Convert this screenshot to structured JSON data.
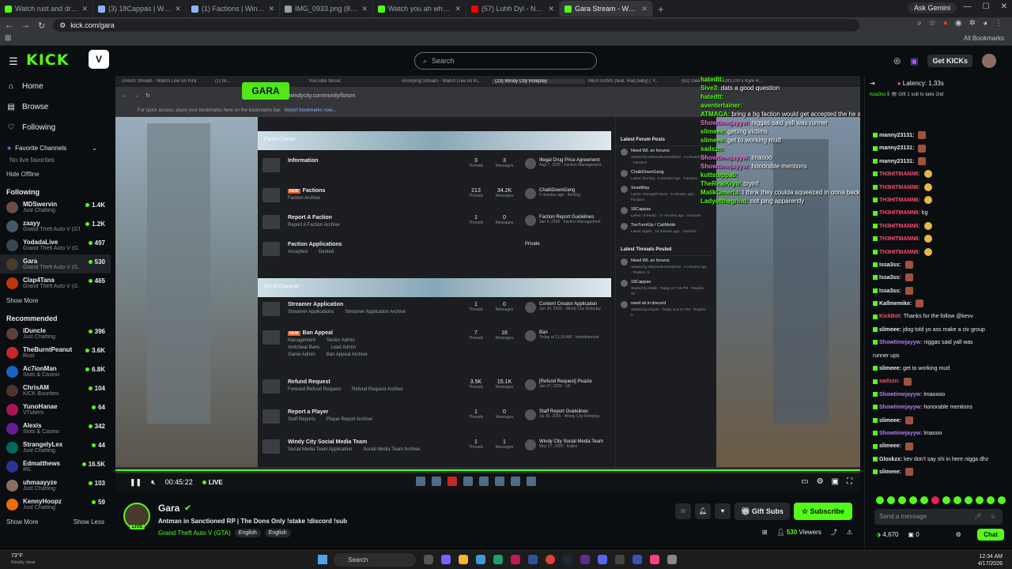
{
  "browser": {
    "tabs": [
      {
        "title": "Watch rust and drive in a new vic...",
        "color": "#53fc18"
      },
      {
        "title": "(3) 18Cappas | Windy City Rol...",
        "color": "#8ab4f8"
      },
      {
        "title": "(1) Factions | Windy City Rolepl...",
        "color": "#8ab4f8"
      },
      {
        "title": "IMG_0933.png (892×280)",
        "color": "#9aa0a6"
      },
      {
        "title": "Watch you ah what? | Streamin...",
        "color": "#53fc18"
      },
      {
        "title": "(57) Luhh Dyl - Nobody Gone L...",
        "color": "#ff0000"
      },
      {
        "title": "Gara Stream - Watch Live on Ki...",
        "color": "#53fc18",
        "active": true
      }
    ],
    "ask_gemini": "Ask Gemini",
    "url": "kick.com/gara",
    "all_bookmarks": "All Bookmarks"
  },
  "header": {
    "logo": "KICK",
    "search_placeholder": "Search",
    "get_kicks": "Get KICKs"
  },
  "sidebar": {
    "nav": [
      {
        "label": "Home",
        "icon": "home-icon"
      },
      {
        "label": "Browse",
        "icon": "browse-icon"
      },
      {
        "label": "Following",
        "icon": "heart-icon"
      }
    ],
    "favorite_channels": "Favorite Channels",
    "no_live_favorites": "No live favorites",
    "hide_offline": "Hide Offline",
    "following_title": "Following",
    "following": [
      {
        "name": "MDSwervin",
        "category": "Just Chatting",
        "viewers": "1.4K",
        "color": "#6d4c41"
      },
      {
        "name": "zaayy",
        "category": "Grand Theft Auto V (GT...",
        "viewers": "1.2K",
        "color": "#455a64"
      },
      {
        "name": "YodadaLive",
        "category": "Grand Theft Auto V (G...",
        "viewers": "497",
        "color": "#37474f"
      },
      {
        "name": "Gara",
        "category": "Grand Theft Auto V (G...",
        "viewers": "530",
        "color": "#4a3a2e"
      },
      {
        "name": "Clap4Tana",
        "category": "Grand Theft Auto V (G...",
        "viewers": "465",
        "color": "#bf360c"
      }
    ],
    "show_more_1": "Show More",
    "recommended_title": "Recommended",
    "recommended": [
      {
        "name": "iDuncle",
        "category": "Just Chatting",
        "viewers": "396",
        "color": "#5d4037"
      },
      {
        "name": "TheBurntPeanut",
        "category": "Rust",
        "viewers": "3.6K",
        "color": "#c62828"
      },
      {
        "name": "Ac7ionMan",
        "category": "Slots & Casino",
        "viewers": "6.8K",
        "color": "#1565c0"
      },
      {
        "name": "ChrisAM",
        "category": "KICK Bounties",
        "viewers": "104",
        "color": "#4e342e"
      },
      {
        "name": "YunoHanae",
        "category": "VTubers",
        "viewers": "64",
        "color": "#ad1457"
      },
      {
        "name": "Alexis",
        "category": "Slots & Casino",
        "viewers": "342",
        "color": "#6a1b9a"
      },
      {
        "name": "StrangelyLex",
        "category": "Just Chatting",
        "viewers": "44",
        "color": "#00695c"
      },
      {
        "name": "Edmatthews",
        "category": "IRL",
        "viewers": "16.5K",
        "color": "#283593"
      },
      {
        "name": "uhmaayyze",
        "category": "Just Chatting",
        "viewers": "103",
        "color": "#8d6e63"
      },
      {
        "name": "KennyHoopz",
        "category": "Just Chatting",
        "viewers": "59",
        "color": "#ef6c00"
      }
    ],
    "show_more_2": "Show More",
    "show_less": "Show Less"
  },
  "video": {
    "inner_tabs": [
      "Grinch Stream - Watch Live on Kick",
      "(1) Bi...",
      "YouTube Music",
      "Annoying Stream - Watch Live on Ki...",
      "(23) Windy City Roleplay",
      "MENTIONS (feat. Raq baby) | Y...",
      "(62) Dee Billz x VonOff1700 x Kyle R..."
    ],
    "inner_url": "windycity.community/forum",
    "inner_bookmarks": "For quick access, place your bookmarks here on the bookmarks bar.",
    "inner_bookmarks_link": "Import bookmarks now...",
    "overlay_logo": "GARA",
    "faction_header": "Faction Center",
    "ooc_header": "Out of Character",
    "forums": [
      {
        "title": "Information",
        "subs": [],
        "threads": "3",
        "messages": "3",
        "last": "Illegal Drug Price Agreement",
        "last_sub": "Aug 7, 2025 · Faction Management"
      },
      {
        "title": "Factions",
        "hot": "NEW",
        "subs": [
          "Faction Archive"
        ],
        "threads": "213",
        "messages": "34.2K",
        "last": "ChalkDownGang",
        "last_sub": "5 minutes ago · fleming"
      },
      {
        "title": "Report A Faction",
        "subs": [
          "Report A Faction Archive"
        ],
        "threads": "1",
        "messages": "0",
        "last": "Faction Report Guidelines",
        "last_sub": "Jan 4, 2025 · Faction Management"
      },
      {
        "title": "Faction Applications",
        "subs": [
          "Accepted",
          "Denied"
        ],
        "threads": "",
        "messages": "",
        "last": "Private",
        "last_sub": ""
      },
      {
        "title": "Streamer Application",
        "subs": [
          "Streamer Applications",
          "Streamer Application Archive"
        ],
        "threads": "1",
        "messages": "0",
        "last": "Content Creator Application",
        "last_sub": "Jun 30, 2025 · Windy City Roleplay"
      },
      {
        "title": "Ban Appeal",
        "hot": "NEW",
        "subs": [
          "Management",
          "Senior Admin",
          "Anticheat Bans",
          "Lead Admin",
          "Game Admin",
          "Ban Appeal Archive"
        ],
        "threads": "7",
        "messages": "16",
        "last": "Ban",
        "last_sub": "Today at 11:10 AM · feedsthemost"
      },
      {
        "title": "Refund Request",
        "subs": [
          "Forward Refund Request",
          "Refund Request Archive"
        ],
        "threads": "3.5K",
        "messages": "15.1K",
        "last": "[Refund Request] Peazie",
        "last_sub": "Jan 27, 2026 · LB"
      },
      {
        "title": "Report a Player",
        "subs": [
          "Staff Reports",
          "Player Report Archive"
        ],
        "threads": "1",
        "messages": "0",
        "last": "Staff Report Guidelines",
        "last_sub": "Jul 30, 2025 · Windy City Roleplay"
      },
      {
        "title": "Windy City Social Media Team",
        "subs": [
          "Social Media Team Application",
          "Social Media Team Archive"
        ],
        "threads": "1",
        "messages": "1",
        "last": "Windy City Social Media Team",
        "last_sub": "May 27, 2026 · Kallex"
      }
    ],
    "threads_label": "Threads",
    "messages_label": "Messages",
    "latest_posts_title": "Latest Forum Posts",
    "latest_posts": [
      {
        "title": "Need WL on forums",
        "meta": "Started by MissunderstoodOne · 4 minutes ago · Factions"
      },
      {
        "title": "ChalkDownGang",
        "meta": "Latest: fleming · 5 minutes ago · Factions"
      },
      {
        "title": "SosaWay",
        "meta": "Latest: GeorgePickens · 5 minutes ago · Factions"
      },
      {
        "title": "18Cappas",
        "meta": "Latest: chriswfd · 17 minutes ago · Factions"
      },
      {
        "title": "TooTurntUp / CaliMobb",
        "meta": "Latest: tigerk · 18 minutes ago · Factions"
      }
    ],
    "latest_threads_title": "Latest Threads Posted",
    "latest_threads": [
      {
        "title": "Need WL on forums",
        "meta": "Started by MissunderstoodOne · 4 minutes ago · Replies: 0"
      },
      {
        "title": "18Cappas",
        "meta": "Started by Malik · Today at 7:26 PM · Replies: 20"
      },
      {
        "title": "need wl in discord",
        "meta": "Started by ishyah · Today at 6:47 PM · Replies: 0"
      }
    ],
    "overlay_chat": [
      {
        "user": "hatedtt:",
        "text": ""
      },
      {
        "user": "Sive3:",
        "text": "dats a good question"
      },
      {
        "user": "hatedtt:",
        "text": ""
      },
      {
        "user": "aventertainer:",
        "text": ""
      },
      {
        "user": "ATMAGA:",
        "text": "bring a bg faction would get accepted the he a troll"
      },
      {
        "user": "Showtimejayyw:",
        "text": "niggas said yall was runner"
      },
      {
        "user": "slimeee:",
        "text": "getting victims"
      },
      {
        "user": "slimeee:",
        "text": "get to working mud"
      },
      {
        "user": "sadszn:",
        "text": ""
      },
      {
        "user": "Showtimejayyw:",
        "text": "lmaooo"
      },
      {
        "user": "Showtimejayyw:",
        "text": "honorable mentions"
      },
      {
        "user": "kuttsteppa0:",
        "text": ""
      },
      {
        "user": "TheRealKryo:",
        "text": "cryinf"
      },
      {
        "user": "MalikOmerta:",
        "text": "I think they coulda squeezed in onna backened"
      },
      {
        "user": "Ladyofthegrind:",
        "text": "not ping apparently"
      }
    ],
    "time": "00:45:22",
    "live": "LIVE"
  },
  "stream": {
    "name": "Gara",
    "live_badge": "LIVE",
    "title": "Antman in Sanctioned RP | The Dons Only !stake !discord !sub",
    "category": "Grand Theft Auto V (GTA)",
    "tags": [
      "English",
      "English"
    ],
    "gift_subs": "Gift Subs",
    "subscribe": "Subscribe",
    "viewers": "530",
    "viewers_label": "Viewers"
  },
  "chat": {
    "latency": "Latency: 1.33s",
    "pinned_user": "Issa3ss",
    "pinned_count": "5",
    "pinned_text": "Gift 1 sub to take 2nd",
    "messages": [
      {
        "user": "manny23131:",
        "text": "",
        "color": "#e8eaed",
        "emote": true
      },
      {
        "user": "manny23131:",
        "text": "",
        "color": "#e8eaed",
        "emote": true
      },
      {
        "user": "manny23131:",
        "text": "",
        "color": "#e8eaed",
        "emote": true
      },
      {
        "user": "TH3HITMANN6:",
        "text": "",
        "color": "#ff4d6d",
        "emote_y": true
      },
      {
        "user": "TH3HITMANN6:",
        "text": "",
        "color": "#ff4d6d",
        "emote_y": true
      },
      {
        "user": "TH3HITMANN6:",
        "text": "",
        "color": "#ff4d6d",
        "emote_y": true
      },
      {
        "user": "TH3HITMANN6:",
        "text": "bg",
        "color": "#ff4d6d"
      },
      {
        "user": "TH3HITMANN6:",
        "text": "",
        "color": "#ff4d6d",
        "emote_y": true
      },
      {
        "user": "TH3HITMANN6:",
        "text": "",
        "color": "#ff4d6d",
        "emote_y": true
      },
      {
        "user": "TH3HITMANN6:",
        "text": "",
        "color": "#ff4d6d",
        "emote_y": true
      },
      {
        "user": "Issa3ss:",
        "text": "",
        "color": "#e8eaed",
        "emote": true
      },
      {
        "user": "Issa3ss:",
        "text": "",
        "color": "#e8eaed",
        "emote": true
      },
      {
        "user": "Issa3ss:",
        "text": "",
        "color": "#e8eaed",
        "emote": true
      },
      {
        "user": "Kallmemike:",
        "text": "",
        "color": "#e8eaed",
        "emote": true
      },
      {
        "user": "KickBot:",
        "text": "Thanks for the follow @kevv",
        "color": "#ff4d6d"
      },
      {
        "user": "slimeee:",
        "text": "jdog told yo ass make a civ group",
        "color": "#e8eaed"
      },
      {
        "user": "Showtimejayyw:",
        "text": "niggas said yall was",
        "color": "#b57cf0"
      },
      {
        "user": "",
        "text": "runner ups",
        "color": "#e8eaed"
      },
      {
        "user": "slimeee:",
        "text": "get to working mud",
        "color": "#e8eaed"
      },
      {
        "user": "sadszn:",
        "text": "",
        "color": "#ff4d6d",
        "emote": true
      },
      {
        "user": "Showtimejayyw:",
        "text": "lmaoooo",
        "color": "#b57cf0"
      },
      {
        "user": "Showtimejayyw:",
        "text": "honorable mentions",
        "color": "#b57cf0"
      },
      {
        "user": "slimeee:",
        "text": "",
        "color": "#e8eaed",
        "emote": true
      },
      {
        "user": "Showtimejayyw:",
        "text": "lmaooo",
        "color": "#b57cf0"
      },
      {
        "user": "slimeee:",
        "text": "",
        "color": "#e8eaed",
        "emote": true
      },
      {
        "user": "Gloxkzx:",
        "text": "kev don't say shi in here nigga dhz",
        "color": "#e8eaed"
      },
      {
        "user": "slimeee:",
        "text": "",
        "color": "#e8eaed",
        "emote": true
      }
    ],
    "placeholder": "Send a message",
    "points": "4,670",
    "zero": "0",
    "chat_button": "Chat"
  },
  "taskbar": {
    "temp": "73°F",
    "weather": "Mostly clear",
    "search": "Search",
    "time": "12:34 AM",
    "date": "4/17/2026"
  }
}
